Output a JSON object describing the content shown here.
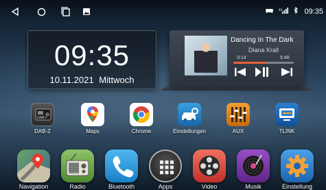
{
  "status_bar": {
    "nav_icons": [
      "back-icon",
      "home-icon",
      "recents-icon",
      "image-icon"
    ],
    "status_icons": [
      "gamepad-icon",
      "signal-icon",
      "bluetooth-icon"
    ],
    "time": "09:35"
  },
  "clock_widget": {
    "time": "09:35",
    "date": "10.11.2021",
    "weekday": "Mittwoch"
  },
  "music_widget": {
    "title": "Dancing In The Dark",
    "artist": "Diana Krall",
    "elapsed": "3:14",
    "duration": "5:48",
    "progress": 0.56,
    "accent": "#e8623a"
  },
  "apps": [
    {
      "label": "DAB-Z",
      "icon": "radio-dab-icon"
    },
    {
      "label": "Maps",
      "icon": "maps-pin-icon"
    },
    {
      "label": "Chrome",
      "icon": "chrome-icon"
    },
    {
      "label": "Einstellungen",
      "icon": "car-settings-icon"
    },
    {
      "label": "AUX",
      "icon": "equalizer-icon"
    },
    {
      "label": "TLINK",
      "icon": "tlink-icon"
    }
  ],
  "dock": [
    {
      "label": "Navigation",
      "icon": "navigation-icon"
    },
    {
      "label": "Radio",
      "icon": "radio-icon"
    },
    {
      "label": "Bluetooth",
      "icon": "phone-icon"
    },
    {
      "label": "Apps",
      "icon": "apps-grid-icon"
    },
    {
      "label": "Video",
      "icon": "film-reel-icon"
    },
    {
      "label": "Musik",
      "icon": "vinyl-icon"
    },
    {
      "label": "Einstellung",
      "icon": "gear-icon"
    }
  ]
}
